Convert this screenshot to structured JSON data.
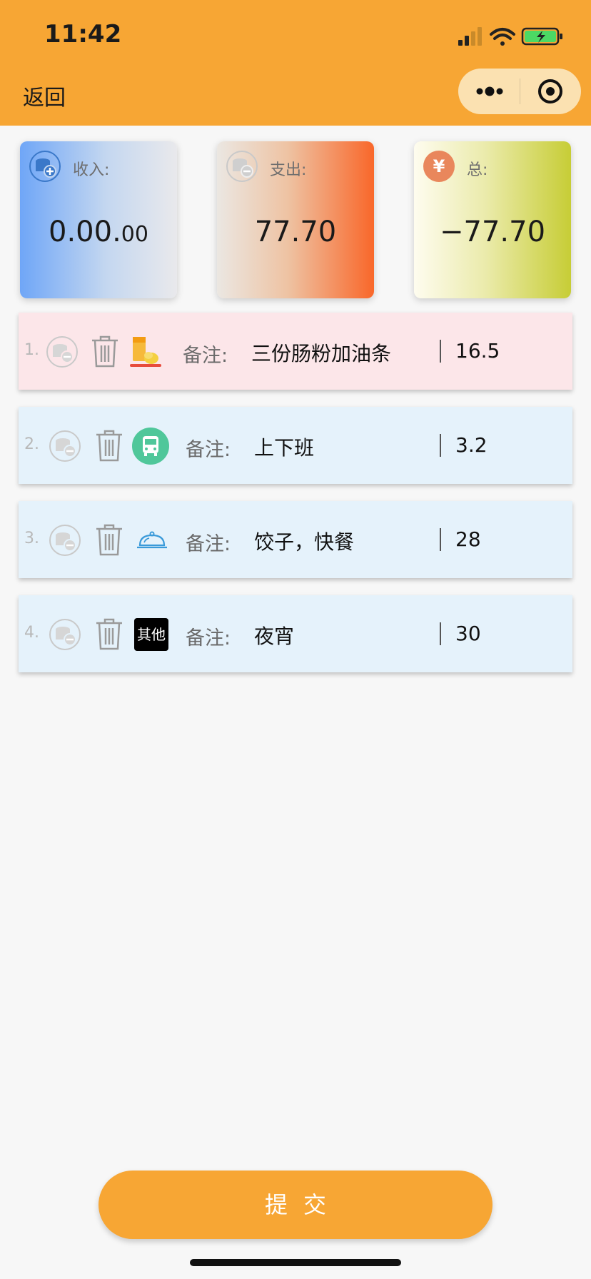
{
  "status_bar": {
    "time": "11:42"
  },
  "nav": {
    "back_label": "返回"
  },
  "summary": {
    "income": {
      "label": "收入:",
      "value_main": "0.00.",
      "value_small": "00"
    },
    "expense": {
      "label": "支出:",
      "value": "77.70"
    },
    "total": {
      "label": "总:",
      "value": "−77.70",
      "icon_symbol": "¥"
    }
  },
  "records": [
    {
      "index": "1.",
      "note_label": "备注:",
      "note": "三份肠粉加油条",
      "amount": "16.5",
      "category_icon": "breakfast-icon"
    },
    {
      "index": "2.",
      "note_label": "备注:",
      "note": "上下班",
      "amount": "3.2",
      "category_icon": "bus-icon"
    },
    {
      "index": "3.",
      "note_label": "备注:",
      "note": "饺子，快餐",
      "amount": "28",
      "category_icon": "meal-cloche-icon"
    },
    {
      "index": "4.",
      "note_label": "备注:",
      "note": "夜宵",
      "amount": "30",
      "category_icon": "other-icon",
      "category_text": "其他"
    }
  ],
  "submit_label": "提交",
  "colors": {
    "accent": "#f7a634",
    "row_highlight": "#fce6e9",
    "row_normal": "#e5f2fb",
    "bus_green": "#4fc79a"
  }
}
